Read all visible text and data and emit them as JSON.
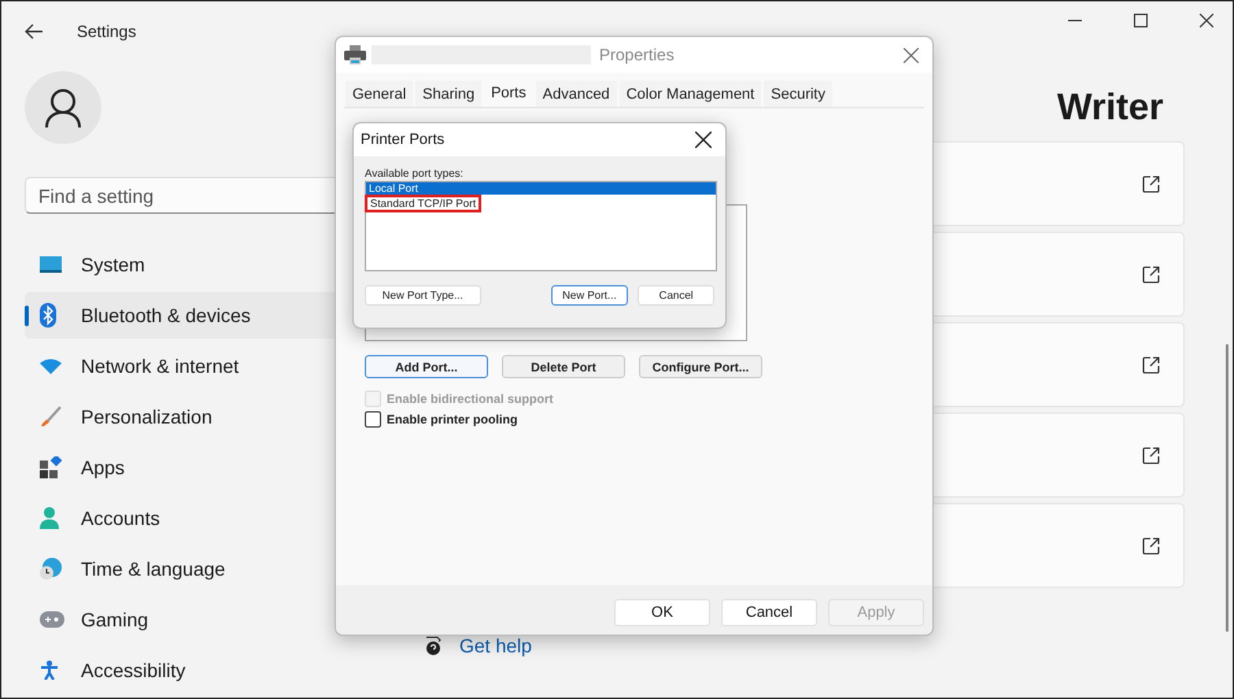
{
  "settings": {
    "title": "Settings",
    "search": {
      "placeholder": "Find a setting"
    },
    "nav": [
      {
        "label": "System",
        "kind": "system",
        "selected": false
      },
      {
        "label": "Bluetooth & devices",
        "kind": "bluetooth",
        "selected": true
      },
      {
        "label": "Network & internet",
        "kind": "network",
        "selected": false
      },
      {
        "label": "Personalization",
        "kind": "personalization",
        "selected": false
      },
      {
        "label": "Apps",
        "kind": "apps",
        "selected": false
      },
      {
        "label": "Accounts",
        "kind": "accounts",
        "selected": false
      },
      {
        "label": "Time & language",
        "kind": "time",
        "selected": false
      },
      {
        "label": "Gaming",
        "kind": "gaming",
        "selected": false
      },
      {
        "label": "Accessibility",
        "kind": "accessibility",
        "selected": false
      }
    ],
    "page_title": "Writer",
    "get_help": "Get help",
    "cards": [
      {
        "kind": "external-link"
      },
      {
        "kind": "external-link"
      },
      {
        "kind": "external-link"
      },
      {
        "kind": "external-link"
      },
      {
        "kind": "external-link"
      }
    ]
  },
  "properties": {
    "title": "Properties",
    "tabs": [
      {
        "label": "General",
        "selected": false
      },
      {
        "label": "Sharing",
        "selected": false
      },
      {
        "label": "Ports",
        "selected": true
      },
      {
        "label": "Advanced",
        "selected": false
      },
      {
        "label": "Color Management",
        "selected": false
      },
      {
        "label": "Security",
        "selected": false
      }
    ],
    "port_buttons": [
      {
        "label": "Add Port...",
        "focused": true
      },
      {
        "label": "Delete Port",
        "focused": false
      },
      {
        "label": "Configure Port...",
        "focused": false
      }
    ],
    "options": [
      {
        "label": "Enable bidirectional support",
        "checked": false,
        "disabled": true
      },
      {
        "label": "Enable printer pooling",
        "checked": false,
        "disabled": false
      }
    ],
    "footer": [
      {
        "label": "OK",
        "disabled": false
      },
      {
        "label": "Cancel",
        "disabled": false
      },
      {
        "label": "Apply",
        "disabled": true
      }
    ]
  },
  "printer_ports": {
    "title": "Printer Ports",
    "list_label": "Available port types:",
    "items": [
      {
        "label": "Local Port",
        "selected": true,
        "highlighted": false
      },
      {
        "label": "Standard TCP/IP Port",
        "selected": false,
        "highlighted": true
      }
    ],
    "buttons": [
      {
        "label": "New Port Type...",
        "focused": false
      },
      {
        "label": "New Port...",
        "focused": true
      },
      {
        "label": "Cancel",
        "focused": false
      }
    ]
  }
}
